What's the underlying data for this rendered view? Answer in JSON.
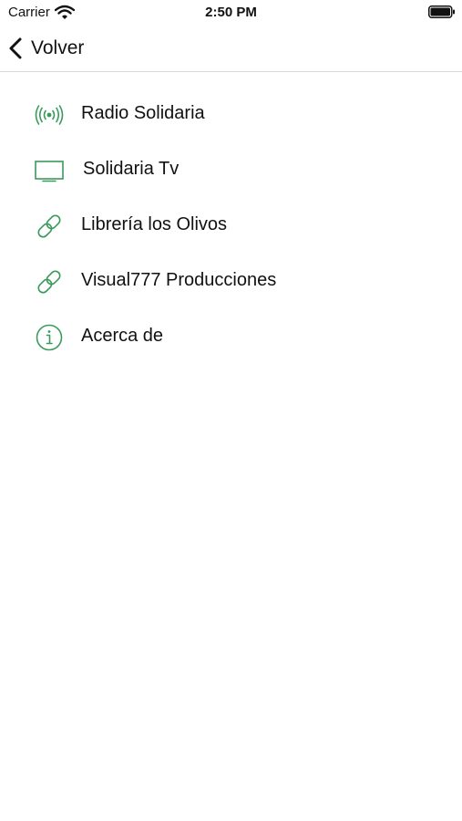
{
  "status_bar": {
    "carrier": "Carrier",
    "time": "2:50 PM",
    "wifi_icon": "wifi-icon",
    "battery_icon": "battery-icon"
  },
  "nav": {
    "back_label": "Volver",
    "back_icon": "chevron-left-icon"
  },
  "accent_color": "#3a9a5c",
  "menu": {
    "items": [
      {
        "label": "Radio Solidaria",
        "icon": "radio-broadcast-icon"
      },
      {
        "label": "Solidaria Tv",
        "icon": "tv-icon"
      },
      {
        "label": "Librería los Olivos",
        "icon": "link-icon"
      },
      {
        "label": "Visual777 Producciones",
        "icon": "link-icon"
      },
      {
        "label": "Acerca de",
        "icon": "info-icon"
      }
    ]
  }
}
